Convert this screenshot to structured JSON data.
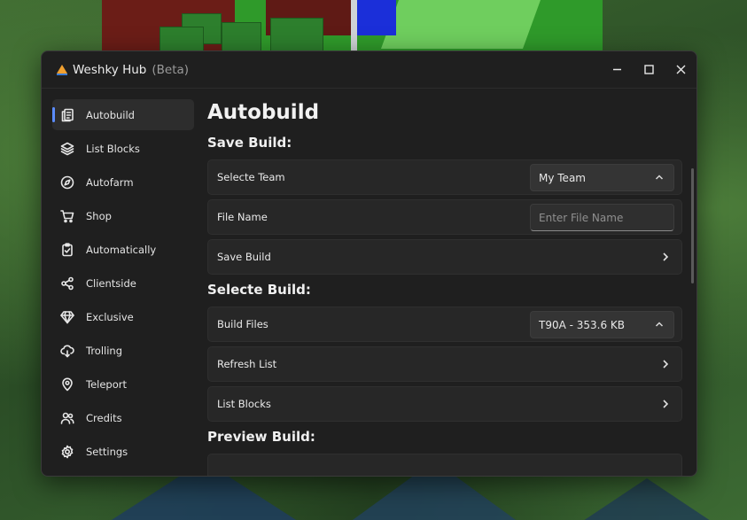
{
  "window": {
    "title": "Weshky Hub",
    "badge": "(Beta)",
    "controls": [
      "minimize",
      "maximize",
      "close"
    ]
  },
  "sidebar": {
    "items": [
      {
        "label": "Autobuild",
        "icon": "document-icon",
        "active": true
      },
      {
        "label": "List Blocks",
        "icon": "layers-icon",
        "active": false
      },
      {
        "label": "Autofarm",
        "icon": "compass-icon",
        "active": false
      },
      {
        "label": "Shop",
        "icon": "cart-icon",
        "active": false
      },
      {
        "label": "Automatically",
        "icon": "clipboard-check-icon",
        "active": false
      },
      {
        "label": "Clientside",
        "icon": "share-icon",
        "active": false
      },
      {
        "label": "Exclusive",
        "icon": "diamond-icon",
        "active": false
      },
      {
        "label": "Trolling",
        "icon": "cloud-arrow-icon",
        "active": false
      },
      {
        "label": "Teleport",
        "icon": "location-pin-icon",
        "active": false
      },
      {
        "label": "Credits",
        "icon": "people-icon",
        "active": false
      },
      {
        "label": "Settings",
        "icon": "gear-icon",
        "active": false
      }
    ]
  },
  "main": {
    "title": "Autobuild",
    "save_section": {
      "title": "Save Build:",
      "team_label": "Selecte Team",
      "team_value": "My Team",
      "file_label": "File Name",
      "file_placeholder": "Enter File Name",
      "save_label": "Save Build"
    },
    "select_section": {
      "title": "Selecte Build:",
      "files_label": "Build Files",
      "files_value": "T90A - 353.6 KB",
      "refresh_label": "Refresh List",
      "list_label": "List Blocks"
    },
    "preview_section": {
      "title": "Preview Build:"
    }
  },
  "colors": {
    "accent": "#5b8cff",
    "window_bg": "#1f1f1f",
    "row_bg": "#272727"
  }
}
